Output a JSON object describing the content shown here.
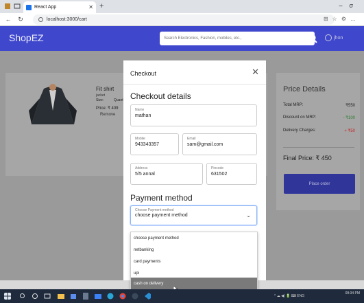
{
  "browser": {
    "tab_title": "React App",
    "url": "localhost:3000/cart"
  },
  "header": {
    "brand": "ShopEZ",
    "search_placeholder": "Search Electronics, Fashion, mobiles, etc.,",
    "user_label": "jhon"
  },
  "cart": {
    "product": {
      "title": "Fit shirt",
      "subtitle": "jacket",
      "size_label": "Size:",
      "quantity_label": "Quant",
      "price": "Price: ₹ 409",
      "remove_label": "Remove"
    }
  },
  "price_details": {
    "title": "Price Details",
    "rows": [
      {
        "label": "Total MRP:",
        "value": "₹550"
      },
      {
        "label": "Discount on MRP:",
        "value": "- ₹100"
      },
      {
        "label": "Delivery Charges:",
        "value": "+ ₹50"
      }
    ],
    "final_price": "Final Price: ₹ 450",
    "place_order_label": "Place order"
  },
  "checkout": {
    "modal_title": "Checkout",
    "details_title": "Checkout details",
    "fields": {
      "name": {
        "label": "Name",
        "value": "mathan"
      },
      "mobile": {
        "label": "Mobile",
        "value": "943343357"
      },
      "email": {
        "label": "Email",
        "value": "sam@gmail.com"
      },
      "address": {
        "label": "Address",
        "value": "5/5 annal"
      },
      "pincode": {
        "label": "Pincode",
        "value": "631502"
      }
    },
    "payment_title": "Payment method",
    "payment_select": {
      "label": "Choose Payment method",
      "value": "choose payment method"
    },
    "payment_options": [
      "choose payment method",
      "netbanking",
      "card payments",
      "upi",
      "cash on delivery"
    ],
    "highlighted_option": "cash on delivery"
  },
  "taskbar": {
    "time": "09:34 PM",
    "lang": "ENG"
  },
  "colors": {
    "brand_blue": "#3f48cc",
    "place_order": "#2f3599",
    "discount_green": "#2e7d32",
    "delivery_red": "#c62828"
  }
}
